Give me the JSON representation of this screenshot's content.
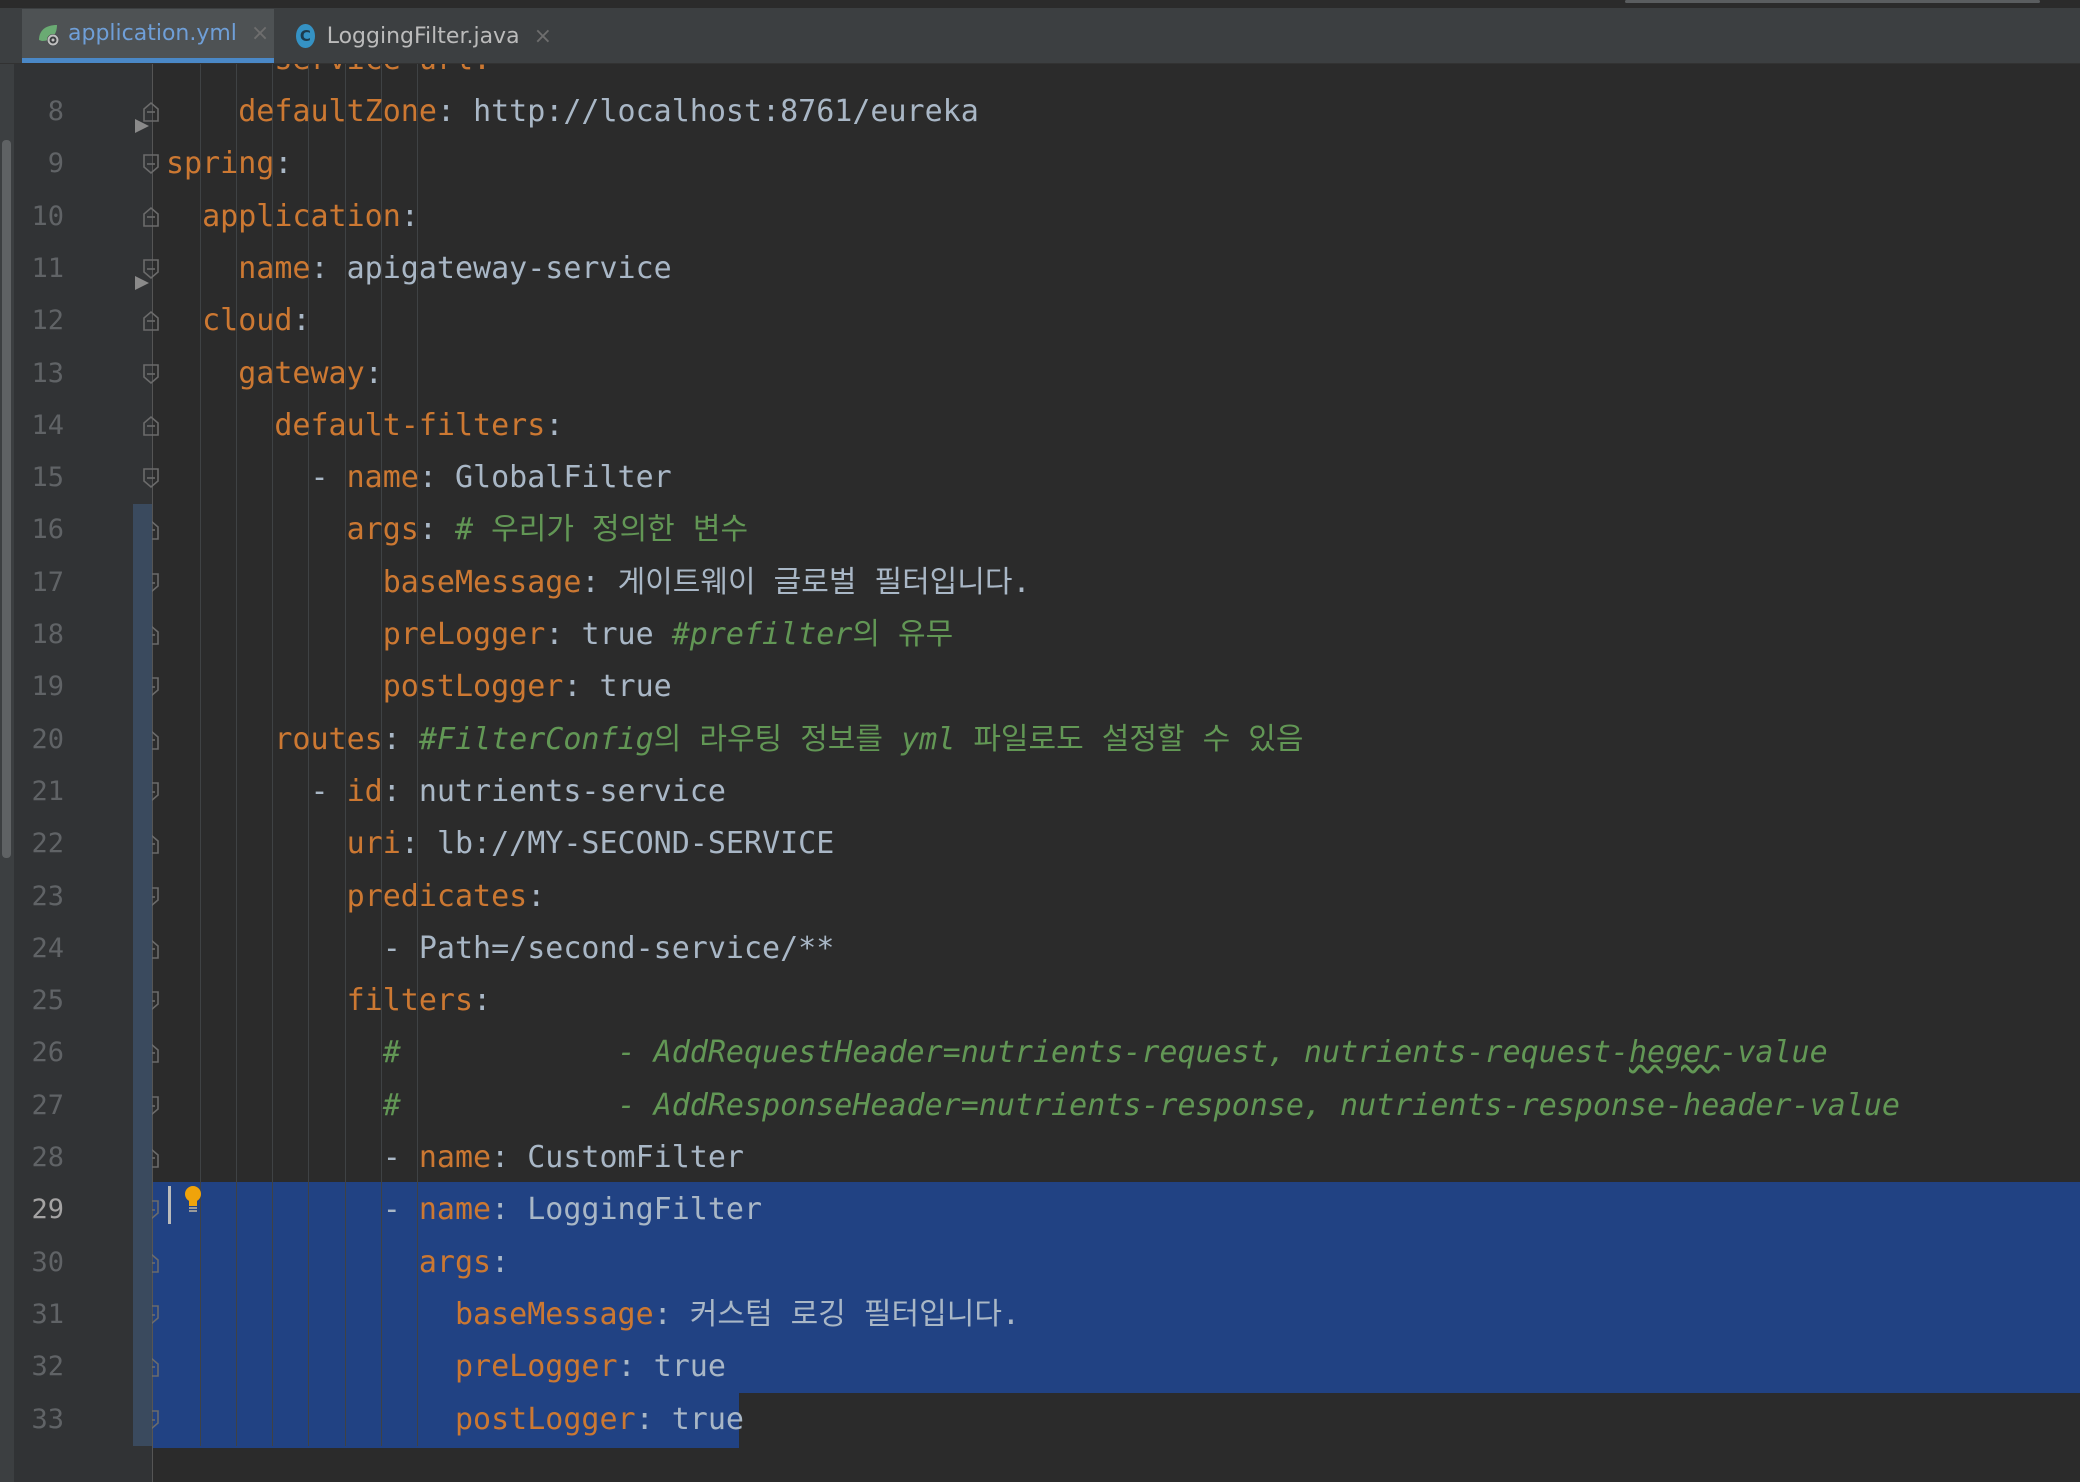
{
  "tabs": [
    {
      "label": "application.yml",
      "icon": "spring-yaml-icon",
      "active": true
    },
    {
      "label": "LoggingFilter.java",
      "icon": "java-class-icon",
      "active": false
    }
  ],
  "tab_close_glyph": "×",
  "java_icon_letter": "C",
  "current_line": "29",
  "lines": [
    {
      "n": "8",
      "indent": "    ",
      "key": "defaultZone",
      "sep": ": ",
      "value": "http://localhost:8761/eureka"
    },
    {
      "n": "9",
      "indent": "",
      "key": "spring",
      "sep": ":"
    },
    {
      "n": "10",
      "indent": "  ",
      "key": "application",
      "sep": ":"
    },
    {
      "n": "11",
      "indent": "    ",
      "key": "name",
      "sep": ": ",
      "value": "apigateway-service"
    },
    {
      "n": "12",
      "indent": "  ",
      "key": "cloud",
      "sep": ":"
    },
    {
      "n": "13",
      "indent": "    ",
      "key": "gateway",
      "sep": ":"
    },
    {
      "n": "14",
      "indent": "      ",
      "key": "default-filters",
      "sep": ":"
    },
    {
      "n": "15",
      "indent": "        ",
      "dash": "- ",
      "key": "name",
      "sep": ": ",
      "value": "GlobalFilter"
    },
    {
      "n": "16",
      "indent": "          ",
      "key": "args",
      "sep": ": ",
      "comment": "# 우리가 정의한 변수"
    },
    {
      "n": "17",
      "indent": "            ",
      "key": "baseMessage",
      "sep": ": ",
      "value": "게이트웨이 글로벌 필터입니다."
    },
    {
      "n": "18",
      "indent": "            ",
      "key": "preLogger",
      "sep": ": ",
      "value": "true ",
      "comment_i": "#prefilter",
      "comment": "의 유무"
    },
    {
      "n": "19",
      "indent": "            ",
      "key": "postLogger",
      "sep": ": ",
      "value": "true"
    },
    {
      "n": "20",
      "indent": "      ",
      "key": "routes",
      "sep": ": ",
      "comment_i": "#FilterConfig",
      "comment": "의 라우팅 정보를 ",
      "comment_i2": "yml",
      "comment2": " 파일로도 설정할 수 있음"
    },
    {
      "n": "21",
      "indent": "        ",
      "dash": "- ",
      "key": "id",
      "sep": ": ",
      "value": "nutrients-service"
    },
    {
      "n": "22",
      "indent": "          ",
      "key": "uri",
      "sep": ": ",
      "value": "lb://MY-SECOND-SERVICE"
    },
    {
      "n": "23",
      "indent": "          ",
      "key": "predicates",
      "sep": ":"
    },
    {
      "n": "24",
      "indent": "            ",
      "dash": "- ",
      "value": "Path=/second-service/**"
    },
    {
      "n": "25",
      "indent": "          ",
      "key": "filters",
      "sep": ":"
    },
    {
      "n": "26",
      "indent": "            ",
      "comment_i": "#            - AddRequestHeader=nutrients-request, nutrients-request-",
      "squiggle": "heger",
      "comment_i2": "-value"
    },
    {
      "n": "27",
      "indent": "            ",
      "comment_i": "#            - AddResponseHeader=nutrients-response, nutrients-response-header-value"
    },
    {
      "n": "28",
      "indent": "            ",
      "dash": "- ",
      "key": "name",
      "sep": ": ",
      "value": "CustomFilter"
    },
    {
      "n": "29",
      "indent": "            ",
      "dash": "- ",
      "key": "name",
      "sep": ": ",
      "value": "LoggingFilter"
    },
    {
      "n": "30",
      "indent": "              ",
      "key": "args",
      "sep": ":"
    },
    {
      "n": "31",
      "indent": "                ",
      "key": "baseMessage",
      "sep": ": ",
      "value": "커스텀 로깅 필터입니다."
    },
    {
      "n": "32",
      "indent": "                ",
      "key": "preLogger",
      "sep": ": ",
      "value": "true"
    },
    {
      "n": "33",
      "indent": "                ",
      "key": "postLogger",
      "sep": ": ",
      "value": "true"
    }
  ],
  "partial_top_line": "      service-url:",
  "colors": {
    "key": "#cc7832",
    "text": "#a9b7c6",
    "comment": "#629755",
    "selection": "#214283",
    "background": "#2b2b2b",
    "gutter": "#313335"
  }
}
